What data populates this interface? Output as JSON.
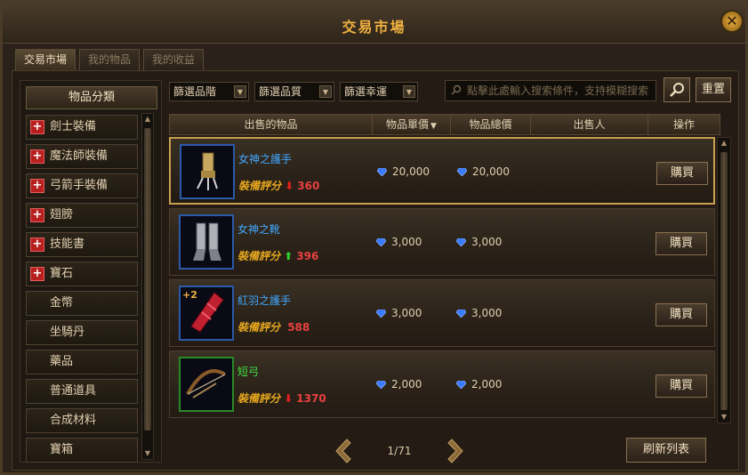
{
  "window": {
    "title": "交易市場",
    "close_symbol": "✕"
  },
  "tabs": [
    {
      "label": "交易市場",
      "active": true
    },
    {
      "label": "我的物品",
      "active": false
    },
    {
      "label": "我的收益",
      "active": false
    }
  ],
  "sidebar": {
    "header": "物品分類",
    "items": [
      {
        "label": "劍士裝備",
        "expandable": true
      },
      {
        "label": "魔法師裝備",
        "expandable": true
      },
      {
        "label": "弓箭手裝備",
        "expandable": true
      },
      {
        "label": "翅膀",
        "expandable": true
      },
      {
        "label": "技能書",
        "expandable": true
      },
      {
        "label": "寶石",
        "expandable": true
      },
      {
        "label": "金幣",
        "expandable": false
      },
      {
        "label": "坐騎丹",
        "expandable": false
      },
      {
        "label": "藥品",
        "expandable": false
      },
      {
        "label": "普通道具",
        "expandable": false
      },
      {
        "label": "合成材料",
        "expandable": false
      },
      {
        "label": "寶箱",
        "expandable": false
      }
    ],
    "plus_symbol": "+"
  },
  "filters": {
    "tier": "篩選品階",
    "quality": "篩選品質",
    "luck": "篩選幸運"
  },
  "search": {
    "placeholder": "點擊此處輸入搜索條件，支持模糊搜索"
  },
  "buttons": {
    "reset": "重置",
    "refresh": "刷新列表",
    "buy": "購買"
  },
  "table": {
    "headers": {
      "item": "出售的物品",
      "unit_price": "物品單價",
      "total_price": "物品總價",
      "seller": "出售人",
      "action": "操作"
    }
  },
  "listings": [
    {
      "name": "女神之護手",
      "name_color": "#40a8ff",
      "border_color": "#2a5aa8",
      "score_label": "裝備評分",
      "trend": "down",
      "trend_symbol": "⬇",
      "score": "360",
      "unit_price": "20,000",
      "total_price": "20,000",
      "seller": "",
      "enhance": "",
      "selected": true,
      "icon": "gauntlet-icon"
    },
    {
      "name": "女神之靴",
      "name_color": "#40a8ff",
      "border_color": "#2a5aa8",
      "score_label": "裝備評分",
      "trend": "up",
      "trend_symbol": "⬆",
      "score": "396",
      "unit_price": "3,000",
      "total_price": "3,000",
      "seller": "",
      "enhance": "",
      "selected": false,
      "icon": "boots-icon"
    },
    {
      "name": "紅羽之護手",
      "name_color": "#40a8ff",
      "border_color": "#2a5aa8",
      "score_label": "裝備評分",
      "trend": "none",
      "trend_symbol": "",
      "score": "588",
      "unit_price": "3,000",
      "total_price": "3,000",
      "seller": "",
      "enhance": "+2",
      "selected": false,
      "icon": "red-gauntlet-icon"
    },
    {
      "name": "短弓",
      "name_color": "#40e040",
      "border_color": "#2a8a2a",
      "score_label": "裝備評分",
      "trend": "down",
      "trend_symbol": "⬇",
      "score": "1370",
      "unit_price": "2,000",
      "total_price": "2,000",
      "seller": "",
      "enhance": "",
      "selected": false,
      "icon": "bow-icon"
    }
  ],
  "pagination": {
    "current": "1/71"
  },
  "colors": {
    "accent": "#f0b040",
    "gem": "#3a7aff"
  }
}
